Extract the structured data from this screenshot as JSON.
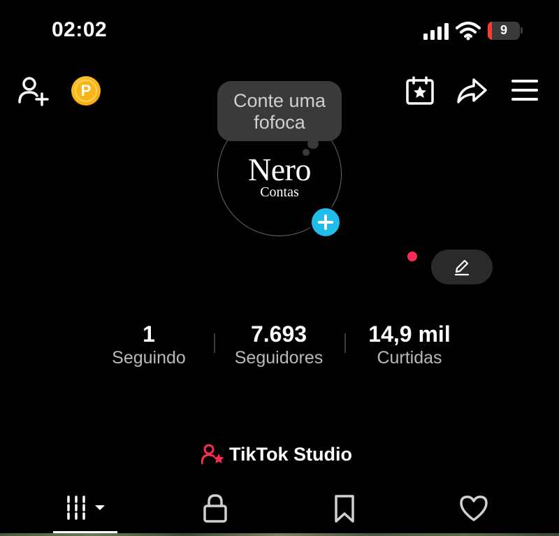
{
  "status_bar": {
    "time": "02:02",
    "battery_level": "9",
    "icons": [
      "cellular-signal-icon",
      "wifi-icon",
      "battery-icon"
    ]
  },
  "header": {
    "icons": [
      "add-friend-icon",
      "coin-icon",
      "calendar-star-icon",
      "share-icon",
      "menu-icon"
    ],
    "coin_letter": "P"
  },
  "profile": {
    "note_bubble": "Conte uma fofoca",
    "avatar_text_main": "Nero",
    "avatar_text_sub": "Contas"
  },
  "stats": [
    {
      "value": "1",
      "label": "Seguindo"
    },
    {
      "value": "7.693",
      "label": "Seguidores"
    },
    {
      "value": "14,9 mil",
      "label": "Curtidas"
    }
  ],
  "studio": {
    "label": "TikTok Studio",
    "icon": "person-star-icon"
  },
  "tabs": [
    {
      "name": "videos",
      "icon": "grid-dropdown-icon",
      "active": true
    },
    {
      "name": "private",
      "icon": "lock-icon",
      "active": false
    },
    {
      "name": "favorites",
      "icon": "bookmark-icon",
      "active": false
    },
    {
      "name": "liked",
      "icon": "heart-icon",
      "active": false
    }
  ],
  "colors": {
    "background": "#000000",
    "accent_blue": "#20bde8",
    "accent_red": "#fe2c55",
    "coin_gold": "#f9b516",
    "battery_low": "#ff3b30"
  }
}
